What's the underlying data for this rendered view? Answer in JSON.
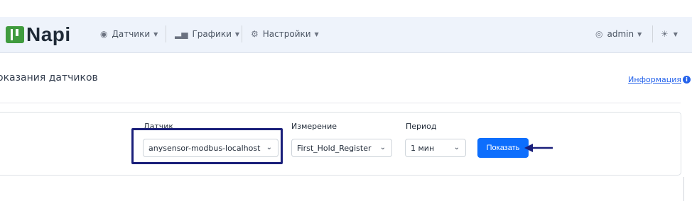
{
  "brand": {
    "name": "Napi",
    "color": "#3f9b3e"
  },
  "nav": {
    "items": [
      {
        "label": "Датчики",
        "icon": "sensor-icon"
      },
      {
        "label": "Графики",
        "icon": "bar-chart-icon"
      },
      {
        "label": "Настройки",
        "icon": "gear-icon"
      }
    ],
    "user": {
      "label": "admin",
      "icon": "user-circle-icon"
    },
    "theme": {
      "icon": "sun-icon"
    }
  },
  "page": {
    "title": "оказания датчиков",
    "info_link": "Информация",
    "info_badge": "i"
  },
  "form": {
    "sensor": {
      "label": "Датчик",
      "value": "anysensor-modbus-localhost"
    },
    "measure": {
      "label": "Измерение",
      "value": "First_Hold_Register"
    },
    "period": {
      "label": "Период",
      "value": "1 мин"
    },
    "submit_label": "Показать"
  },
  "colors": {
    "accent": "#0d6efd",
    "highlight": "#1a1f7a",
    "navbar_bg": "#eef3fb"
  }
}
